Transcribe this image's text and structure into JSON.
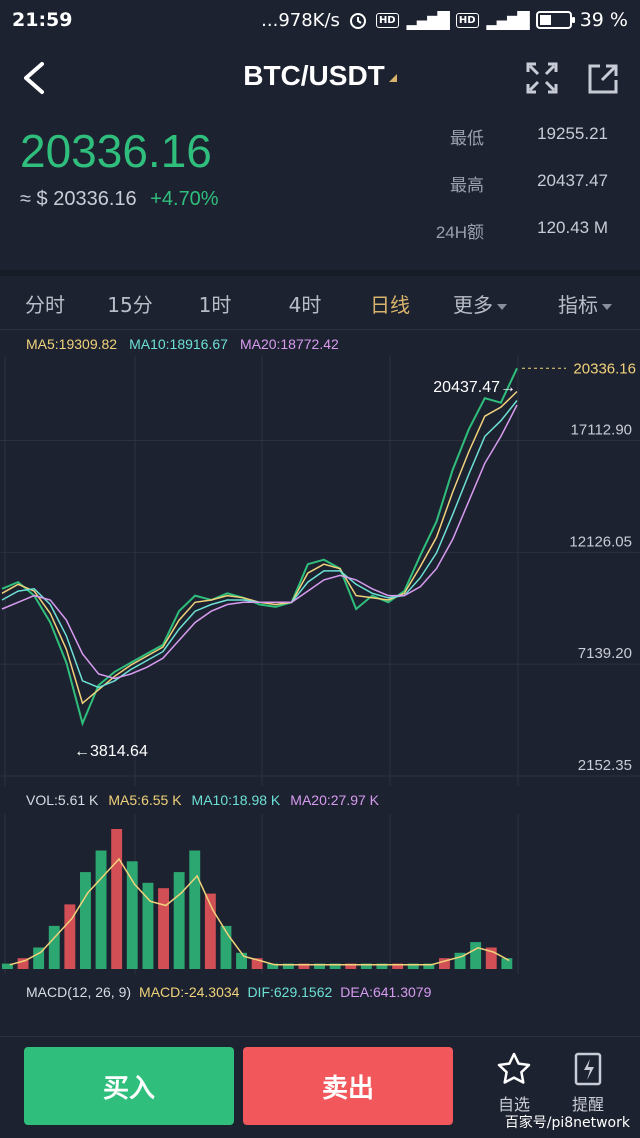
{
  "status_bar": {
    "time": "21:59",
    "net_speed": "...978K/s",
    "hd": "HD",
    "net_4g": "4G",
    "battery": "39 %",
    "battery_level": 0.39
  },
  "header": {
    "pair": "BTC/USDT",
    "icons": [
      "back-arrow-icon",
      "fullscreen-icon",
      "share-icon"
    ]
  },
  "ticker": {
    "last_price": "20336.16",
    "usd_price": "≈ $ 20336.16",
    "change": "+4.70%",
    "low_label": "最低",
    "low": "19255.21",
    "high_label": "最高",
    "high": "20437.47",
    "vol_label": "24H额",
    "vol": "120.43 M"
  },
  "tabs": [
    {
      "label": "分时"
    },
    {
      "label": "15分"
    },
    {
      "label": "1时"
    },
    {
      "label": "4时"
    },
    {
      "label": "日线"
    },
    {
      "label": "更多"
    },
    {
      "label": "指标"
    }
  ],
  "ma": {
    "ma5": "MA5:19309.82",
    "ma10": "MA10:18916.67",
    "ma20": "MA20:18772.42"
  },
  "vol": {
    "vol": "VOL:5.61 K",
    "ma5": "MA5:6.55 K",
    "ma10": "MA10:18.98 K",
    "ma20": "MA20:27.97 K"
  },
  "macd": {
    "label": "MACD(12, 26, 9)",
    "macd": "MACD:-24.3034",
    "dif": "DIF:629.1562",
    "dea": "DEA:641.3079"
  },
  "chart_data": {
    "type": "line",
    "y_ticks": [
      "17112.90",
      "12126.05",
      "7139.20",
      "2152.35"
    ],
    "ylim": [
      2152.35,
      20437.47
    ],
    "last_price_label": "20336.16",
    "high_marker": "20437.47→",
    "low_marker": "←3814.64",
    "colors": {
      "up": "#2fbe7c",
      "down": "#f2575c",
      "ma5": "#f1d27b",
      "ma10": "#6de0d6",
      "ma20": "#d79bf0"
    },
    "series": [
      {
        "values": [
          10500,
          10800,
          10200,
          9000,
          7200,
          4500,
          6200,
          6800,
          7200,
          7600,
          8000,
          9500,
          10200,
          10000,
          10300,
          10100,
          9800,
          9700,
          9900,
          11600,
          11800,
          11400,
          9600,
          10200,
          9900,
          10400,
          12000,
          13500,
          15800,
          17600,
          19000,
          18800,
          20336
        ]
      },
      {
        "values": [
          10300,
          10700,
          10400,
          9400,
          7800,
          5400,
          6000,
          6600,
          7100,
          7500,
          7900,
          9100,
          9900,
          10000,
          10200,
          10100,
          9900,
          9800,
          9900,
          11200,
          11600,
          11400,
          10200,
          10100,
          10000,
          10300,
          11500,
          12800,
          14800,
          16600,
          18200,
          18600,
          19300
        ]
      },
      {
        "values": [
          10000,
          10400,
          10500,
          9800,
          8400,
          6400,
          6100,
          6400,
          6900,
          7300,
          7700,
          8700,
          9500,
          9800,
          10000,
          10000,
          9900,
          9900,
          9900,
          10800,
          11300,
          11300,
          10700,
          10300,
          10100,
          10200,
          11000,
          12100,
          13800,
          15600,
          17300,
          18000,
          18900
        ]
      },
      {
        "values": [
          9600,
          9900,
          10200,
          10000,
          9100,
          7600,
          6700,
          6500,
          6700,
          7000,
          7400,
          8200,
          9000,
          9500,
          9800,
          9900,
          9900,
          9900,
          9900,
          10400,
          10900,
          11100,
          10900,
          10500,
          10200,
          10200,
          10600,
          11400,
          12700,
          14400,
          16100,
          17300,
          18700
        ]
      }
    ],
    "volume": [
      1,
      2,
      4,
      8,
      12,
      18,
      22,
      26,
      20,
      16,
      15,
      18,
      22,
      14,
      8,
      3,
      2,
      1,
      1,
      1,
      1,
      1,
      1,
      1,
      1,
      1,
      1,
      1,
      2,
      3,
      5,
      4,
      2
    ]
  },
  "actions": {
    "buy": "买入",
    "sell": "卖出",
    "watch": "自选",
    "alert": "提醒"
  },
  "watermark": "百家号/pi8network"
}
